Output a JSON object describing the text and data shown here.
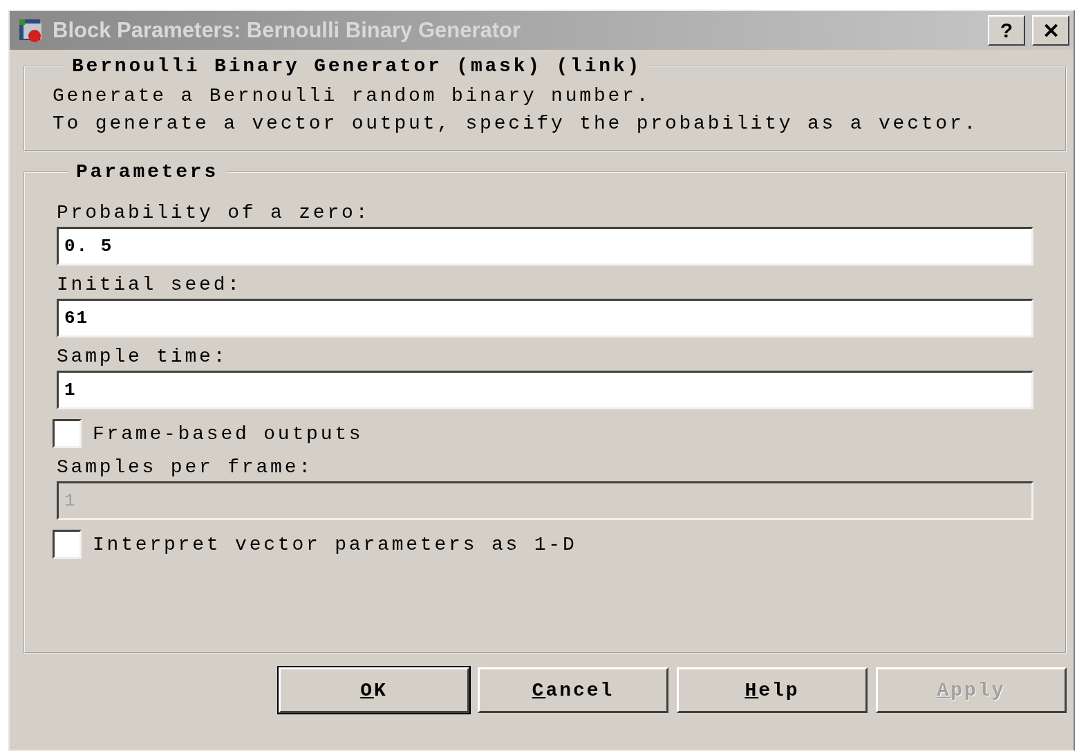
{
  "window": {
    "title": "Block Parameters: Bernoulli Binary Generator",
    "help_button": "?",
    "close_button": "✕"
  },
  "description_group": {
    "title": "Bernoulli Binary Generator (mask) (link)",
    "lines": [
      "Generate a Bernoulli random binary number.",
      "To generate a vector output, specify the probability as a vector."
    ]
  },
  "parameters_group": {
    "title": "Parameters",
    "items": [
      {
        "kind": "field",
        "label": "Probability of a zero:",
        "value": "0. 5",
        "disabled": false
      },
      {
        "kind": "field",
        "label": "Initial seed:",
        "value": "61",
        "disabled": false
      },
      {
        "kind": "field",
        "label": "Sample time:",
        "value": "1",
        "disabled": false
      },
      {
        "kind": "checkbox",
        "label": "Frame-based outputs",
        "checked": false
      },
      {
        "kind": "field",
        "label": "Samples per frame:",
        "value": "1",
        "disabled": true
      },
      {
        "kind": "checkbox",
        "label": "Interpret vector parameters as 1-D",
        "checked": false
      }
    ]
  },
  "buttons": [
    {
      "label": "OK",
      "disabled": false,
      "default": true
    },
    {
      "label": "Cancel",
      "disabled": false,
      "default": false
    },
    {
      "label": "Help",
      "disabled": false,
      "default": false
    },
    {
      "label": "Apply",
      "disabled": true,
      "default": false
    }
  ]
}
